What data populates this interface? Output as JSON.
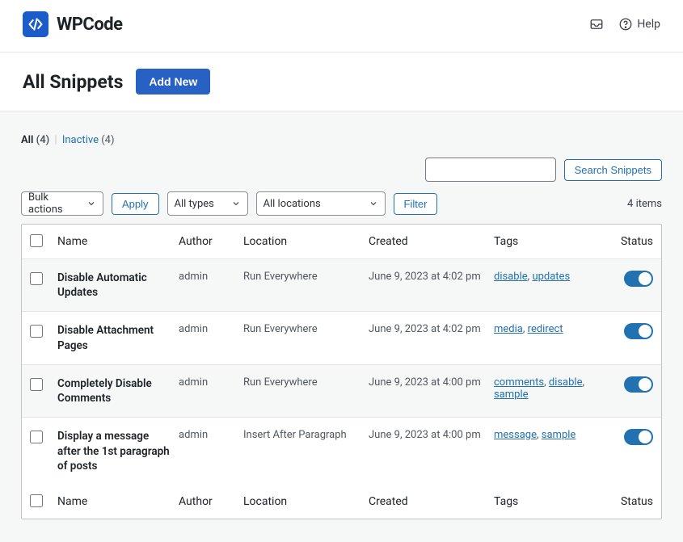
{
  "topbar": {
    "brand": "WPCode",
    "help_label": "Help"
  },
  "header": {
    "title": "All Snippets",
    "add_new": "Add New"
  },
  "subsubsub": {
    "all_label": "All",
    "all_count": "(4)",
    "inactive_label": "Inactive",
    "inactive_count": "(4)"
  },
  "search": {
    "button": "Search Snippets"
  },
  "filters": {
    "bulk_actions": "Bulk actions",
    "apply": "Apply",
    "all_types": "All types",
    "all_locations": "All locations",
    "filter": "Filter",
    "items_count": "4 items"
  },
  "columns": {
    "name": "Name",
    "author": "Author",
    "location": "Location",
    "created": "Created",
    "tags": "Tags",
    "status": "Status"
  },
  "rows": [
    {
      "name": "Disable Automatic Updates",
      "author": "admin",
      "location": "Run Everywhere",
      "created": "June 9, 2023 at 4:02 pm",
      "tags": [
        "disable",
        "updates"
      ],
      "status": true
    },
    {
      "name": "Disable Attachment Pages",
      "author": "admin",
      "location": "Run Everywhere",
      "created": "June 9, 2023 at 4:02 pm",
      "tags": [
        "media",
        "redirect"
      ],
      "status": true
    },
    {
      "name": "Completely Disable Comments",
      "author": "admin",
      "location": "Run Everywhere",
      "created": "June 9, 2023 at 4:00 pm",
      "tags": [
        "comments",
        "disable",
        "sample"
      ],
      "status": true
    },
    {
      "name": "Display a message after the 1st paragraph of posts",
      "author": "admin",
      "location": "Insert After Paragraph",
      "created": "June 9, 2023 at 4:00 pm",
      "tags": [
        "message",
        "sample"
      ],
      "status": true
    }
  ]
}
